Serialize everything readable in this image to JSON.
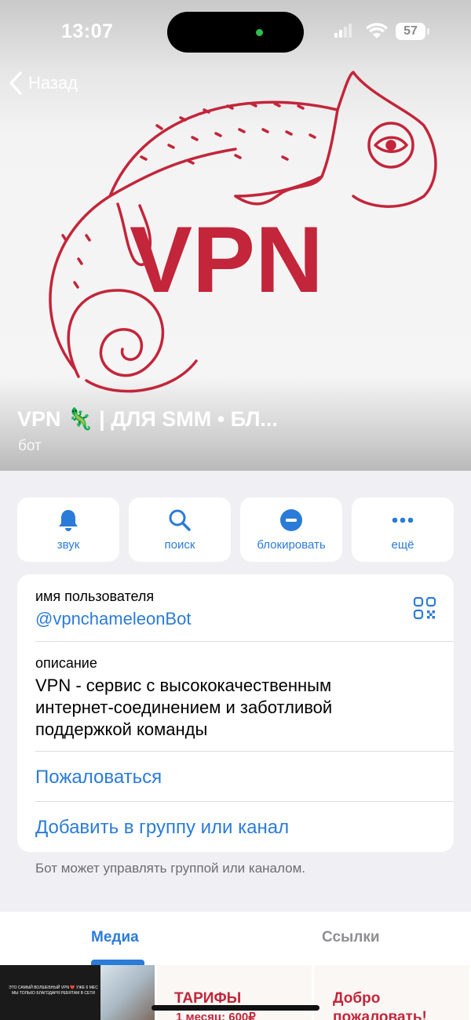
{
  "status_bar": {
    "time": "13:07",
    "battery": "57"
  },
  "nav": {
    "back_label": "Назад"
  },
  "header": {
    "title": "VPN 🦎 | ДЛЯ SMM • БЛ...",
    "subtitle": "бот",
    "avatar_text": "VPN"
  },
  "actions": [
    {
      "label": "звук",
      "icon": "bell-icon"
    },
    {
      "label": "поиск",
      "icon": "search-icon"
    },
    {
      "label": "блокировать",
      "icon": "block-icon"
    },
    {
      "label": "ещё",
      "icon": "more-icon"
    }
  ],
  "info": {
    "username_label": "имя пользователя",
    "username": "@vpnchameleonBot",
    "description_label": "описание",
    "description_lines": [
      "VPN - сервис с высококачественным",
      "интернет-соединением и заботливой",
      "поддержкой команды"
    ],
    "report": "Пожаловаться",
    "add_to_group": "Добавить в группу или канал"
  },
  "footnote": "Бот может управлять группой или каналом.",
  "tabs": {
    "media": "Медиа",
    "links": "Ссылки"
  },
  "media": {
    "thumb1_text": "ЭТО САМЫЙ ВОЛШЕБНЫЙ VPN ❤️ УЖЕ 6 МЕС МЫ ТОЛЬКО БЛАГОДАРЯ РЕБЯТАМ В СЕТИ",
    "thumb2_title": "ТАРИФЫ",
    "thumb2_line": "1 месяц: 600₽",
    "thumb3_line1": "Добро",
    "thumb3_line2": "пожаловать!"
  },
  "colors": {
    "accent": "#2b7bd8",
    "brand_red": "#c3253a",
    "background": "#efeff4"
  }
}
